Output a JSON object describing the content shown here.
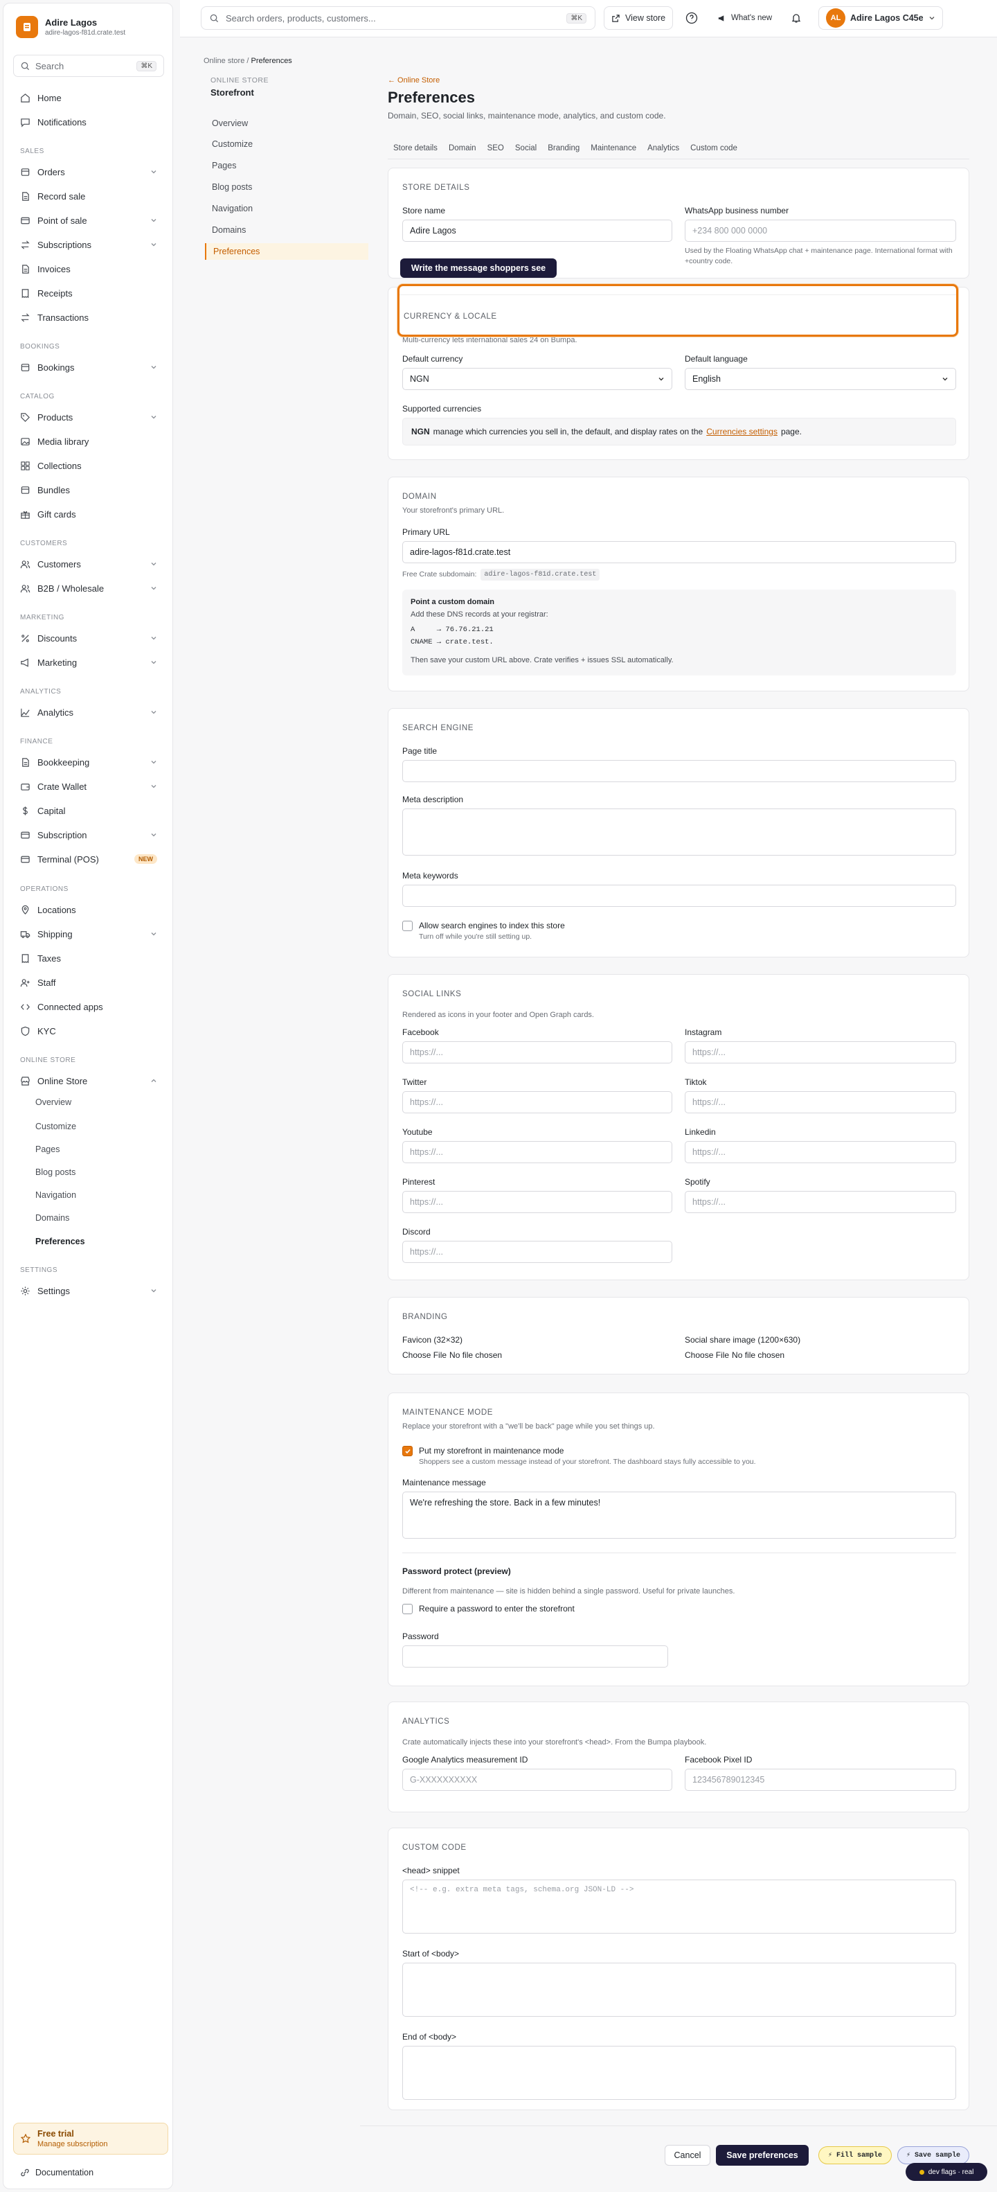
{
  "brand": {
    "name": "Adire Lagos",
    "subdomain": "adire-lagos-f81d.crate.test"
  },
  "sidebar": {
    "search_label": "Search",
    "search_kbd": "⌘K",
    "home": "Home",
    "notifications": "Notifications",
    "sec_sales": "SALES",
    "orders": "Orders",
    "record_sale": "Record sale",
    "point_of_sale": "Point of sale",
    "subscriptions": "Subscriptions",
    "invoices": "Invoices",
    "receipts": "Receipts",
    "transactions": "Transactions",
    "sec_bookings": "BOOKINGS",
    "bookings": "Bookings",
    "sec_catalog": "CATALOG",
    "products": "Products",
    "media_library": "Media library",
    "collections": "Collections",
    "bundles": "Bundles",
    "gift_cards": "Gift cards",
    "sec_customers": "CUSTOMERS",
    "customers": "Customers",
    "b2b": "B2B / Wholesale",
    "sec_marketing": "MARKETING",
    "discounts": "Discounts",
    "marketing": "Marketing",
    "sec_analytics": "ANALYTICS",
    "analytics": "Analytics",
    "sec_finance": "FINANCE",
    "bookkeeping": "Bookkeeping",
    "crate_wallet": "Crate Wallet",
    "capital": "Capital",
    "subscription": "Subscription",
    "terminal": "Terminal (POS)",
    "new_badge": "NEW",
    "sec_operations": "OPERATIONS",
    "locations": "Locations",
    "shipping": "Shipping",
    "taxes": "Taxes",
    "staff": "Staff",
    "connected_apps": "Connected apps",
    "kyc": "KYC",
    "sec_online_store": "ONLINE STORE",
    "online_store": "Online Store",
    "os_sub": [
      "Overview",
      "Customize",
      "Pages",
      "Blog posts",
      "Navigation",
      "Domains",
      "Preferences"
    ],
    "sec_settings": "SETTINGS",
    "settings": "Settings",
    "trial_title": "Free trial",
    "trial_sub": "Manage subscription",
    "documentation": "Documentation"
  },
  "topbar": {
    "search_placeholder": "Search orders, products, customers...",
    "search_kbd": "⌘K",
    "view_store": "View store",
    "whats_new": "What's new",
    "avatar_initials": "AL",
    "account_name": "Adire Lagos C45e"
  },
  "storenav": {
    "breadcrumb_root": "Online store",
    "breadcrumb_sep": "/",
    "breadcrumb_current": "Preferences",
    "heading": "ONLINE STORE",
    "title": "Storefront",
    "items": [
      "Overview",
      "Customize",
      "Pages",
      "Blog posts",
      "Navigation",
      "Domains",
      "Preferences"
    ]
  },
  "page": {
    "back": "← Online Store",
    "title": "Preferences",
    "subtitle": "Domain, SEO, social links, maintenance mode, analytics, and custom code.",
    "tabs": [
      "Store details",
      "Domain",
      "SEO",
      "Social",
      "Branding",
      "Maintenance",
      "Analytics",
      "Custom code"
    ]
  },
  "store_details": {
    "title": "STORE DETAILS",
    "store_name_label": "Store name",
    "store_name_value": "Adire Lagos",
    "whatsapp_label": "WhatsApp business number",
    "whatsapp_placeholder": "+234 800 000 0000",
    "whatsapp_hint": "Used by the Floating WhatsApp chat + maintenance page. International format with +country code.",
    "callout": "Write the message shoppers see"
  },
  "currency": {
    "title": "CURRENCY & LOCALE",
    "desc": "Multi-currency lets international sales 24 on Bumpa.",
    "currency_label": "Default currency",
    "currency_value": "NGN",
    "language_label": "Default language",
    "language_value": "English",
    "supported_label": "Supported currencies",
    "supported_code": "NGN",
    "supported_text": "manage which currencies you sell in, the default, and display rates on the",
    "supported_link": "Currencies settings",
    "supported_tail": "page."
  },
  "domain": {
    "title": "DOMAIN",
    "desc": "Your storefront's primary URL.",
    "primary_label": "Primary URL",
    "primary_value": "adire-lagos-f81d.crate.test",
    "free_label": "Free Crate subdomain:",
    "free_value": "adire-lagos-f81d.crate.test",
    "custom_title": "Point a custom domain",
    "custom_desc": "Add these DNS records at your registrar:",
    "rec_a": "A     → 76.76.21.21",
    "rec_cname": "CNAME → crate.test.",
    "custom_foot": "Then save your custom URL above. Crate verifies + issues SSL automatically."
  },
  "seo": {
    "title": "SEARCH ENGINE",
    "page_title_label": "Page title",
    "meta_desc_label": "Meta description",
    "meta_kw_label": "Meta keywords",
    "index_label": "Allow search engines to index this store",
    "index_hint": "Turn off while you're still setting up."
  },
  "social": {
    "title": "SOCIAL LINKS",
    "desc": "Rendered as icons in your footer and Open Graph cards.",
    "placeholder": "https://...",
    "fields": [
      "Facebook",
      "Instagram",
      "Twitter",
      "Tiktok",
      "Youtube",
      "Linkedin",
      "Pinterest",
      "Spotify",
      "Discord"
    ]
  },
  "branding": {
    "title": "BRANDING",
    "favicon_label": "Favicon (32×32)",
    "social_label": "Social share image (1200×630)",
    "choose": "Choose File",
    "none": "No file chosen"
  },
  "maintenance": {
    "title": "MAINTENANCE MODE",
    "desc": "Replace your storefront with a \"we'll be back\" page while you set things up.",
    "toggle_label": "Put my storefront in maintenance mode",
    "toggle_hint": "Shoppers see a custom message instead of your storefront. The dashboard stays fully accessible to you.",
    "message_label": "Maintenance message",
    "message_value": "We're refreshing the store. Back in a few minutes!",
    "pw_title": "Password protect (preview)",
    "pw_desc": "Different from maintenance — site is hidden behind a single password. Useful for private launches.",
    "pw_toggle": "Require a password to enter the storefront",
    "pw_label": "Password"
  },
  "analytics": {
    "title": "ANALYTICS",
    "desc": "Crate automatically injects these into your storefront's <head>. From the Bumpa playbook.",
    "ga_label": "Google Analytics measurement ID",
    "ga_placeholder": "G-XXXXXXXXXX",
    "fb_label": "Facebook Pixel ID",
    "fb_placeholder": "123456789012345"
  },
  "custom_code": {
    "title": "CUSTOM CODE",
    "head_label": "<head> snippet",
    "head_placeholder": "<!-- e.g. extra meta tags, schema.org JSON-LD -->",
    "body_start_label": "Start of <body>",
    "body_end_label": "End of <body>"
  },
  "footer": {
    "cancel": "Cancel",
    "save": "Save preferences",
    "fill_sample": "⚡ Fill sample",
    "save_sample": "⚡ Save sample",
    "dev_flags": "dev flags · real"
  },
  "colors": {
    "accent": "#e8780d",
    "dark": "#1d1b3a"
  }
}
